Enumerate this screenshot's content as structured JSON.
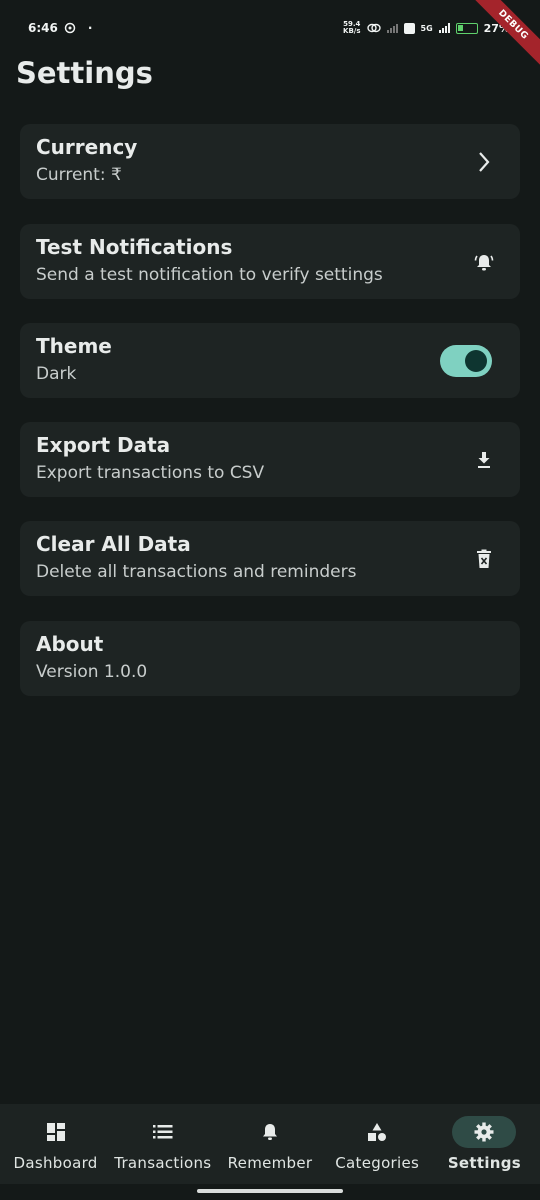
{
  "status_bar": {
    "time": "6:46",
    "dot": "·",
    "net_speed_value": "59.4",
    "net_speed_unit": "KB/s",
    "network": "5G",
    "battery": "27%"
  },
  "debug_banner": "DEBUG",
  "page": {
    "title": "Settings"
  },
  "settings": [
    {
      "title": "Currency",
      "subtitle": "Current: ₹",
      "trailing": "chevron-right-icon"
    },
    {
      "title": "Test Notifications",
      "subtitle": "Send a test notification to verify settings",
      "trailing": "bell-ring-icon"
    },
    {
      "title": "Theme",
      "subtitle": "Dark",
      "trailing": "toggle",
      "toggle_on": true
    },
    {
      "title": "Export Data",
      "subtitle": "Export transactions to CSV",
      "trailing": "download-icon"
    },
    {
      "title": "Clear All Data",
      "subtitle": "Delete all transactions and reminders",
      "trailing": "delete-icon"
    },
    {
      "title": "About",
      "subtitle": "Version 1.0.0"
    }
  ],
  "bottom_nav": [
    {
      "label": "Dashboard",
      "icon": "dashboard-icon"
    },
    {
      "label": "Transactions",
      "icon": "list-icon"
    },
    {
      "label": "Remember",
      "icon": "bell-icon"
    },
    {
      "label": "Categories",
      "icon": "categories-icon"
    },
    {
      "label": "Settings",
      "icon": "gear-icon",
      "active": true
    }
  ],
  "colors": {
    "background": "#141918",
    "card": "#1e2423",
    "accent": "#7fd1c1",
    "nav_active_pill": "#2f4b46",
    "debug": "#a4242b"
  }
}
